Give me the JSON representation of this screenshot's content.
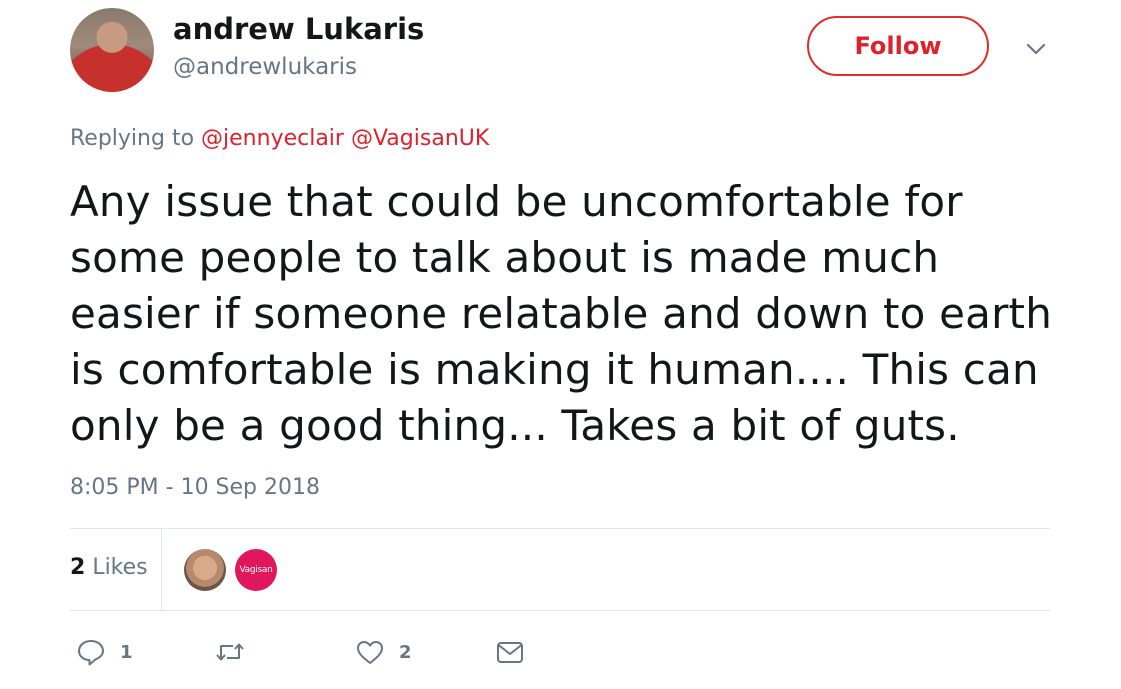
{
  "author": {
    "name": "andrew Lukaris",
    "handle": "@andrewlukaris"
  },
  "follow_label": "Follow",
  "reply_context": {
    "prefix": "Replying to",
    "mentions": [
      "@jennyeclair",
      "@VagisanUK"
    ]
  },
  "tweet_lines": [
    "Any issue that could be uncomfortable for",
    "some people to talk about is made much",
    "easier if someone relatable and down to earth",
    "is comfortable is making it human.... This can",
    "only be a good thing... Takes a bit of guts."
  ],
  "timestamp": "8:05 PM - 10 Sep 2018",
  "likes": {
    "count": "2",
    "label": "Likes",
    "likers": [
      {
        "name": "avatar-andrew"
      },
      {
        "name": "avatar-vagisan",
        "text": "Vagisan"
      }
    ]
  },
  "actions": {
    "reply_count": "1",
    "retweet_count": "",
    "like_count": "2"
  },
  "colors": {
    "accent": "#e0202b",
    "muted": "#657786",
    "vagisan_brand": "#e1175e"
  },
  "icons": [
    "reply-icon",
    "retweet-icon",
    "heart-icon",
    "message-icon",
    "chevron-down-icon"
  ]
}
